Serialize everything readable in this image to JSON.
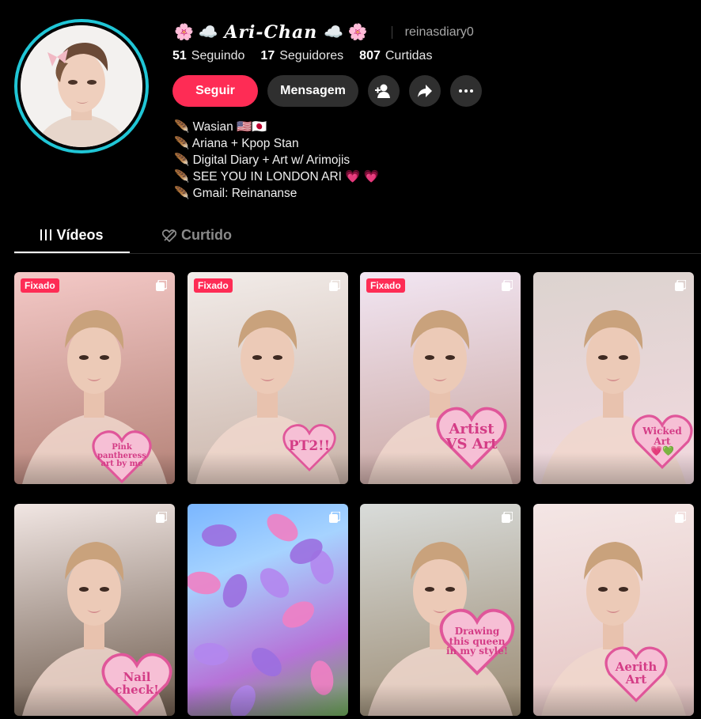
{
  "profile": {
    "display_name": "Ari-Chan",
    "emoji_left": "🌸 ☁️",
    "emoji_right": "☁️ 🌸",
    "username": "reinasdiary0",
    "avatar_icon": "avatar-photo"
  },
  "stats": [
    {
      "value": "51",
      "label": "Seguindo"
    },
    {
      "value": "17",
      "label": "Seguidores"
    },
    {
      "value": "807",
      "label": "Curtidas"
    }
  ],
  "actions": {
    "follow_label": "Seguir",
    "message_label": "Mensagem",
    "add_friend_icon": "add-friend-icon",
    "share_icon": "share-icon",
    "more_icon": "more-icon"
  },
  "bio": [
    "🪶 Wasian 🇺🇸🇯🇵",
    "🪶 Ariana + Kpop Stan",
    "🪶 Digital Diary + Art w/ Arimojis",
    "🪶 SEE YOU IN LONDON ARI 💗 💗",
    "🪶 Gmail: Reinananse"
  ],
  "tabs": [
    {
      "label": "Vídeos",
      "icon": "grid-icon",
      "active": true
    },
    {
      "label": "Curtido",
      "icon": "heart-icon",
      "active": false
    }
  ],
  "videos": [
    {
      "pinned": true,
      "badge": "Fixado",
      "caption": [
        "Pink",
        "pantheress",
        "art by me"
      ],
      "bg": [
        "#f4c9c7",
        "#b48277"
      ]
    },
    {
      "pinned": true,
      "badge": "Fixado",
      "caption": [
        "PT2!!"
      ],
      "bg": [
        "#f2ece9",
        "#c9b3a8"
      ]
    },
    {
      "pinned": true,
      "badge": "Fixado",
      "caption": [
        "Artist",
        "VS Art"
      ],
      "bg": [
        "#f2e6f3",
        "#caa7a1"
      ]
    },
    {
      "pinned": false,
      "badge": "",
      "caption": [
        "Wicked",
        "Art",
        "💗💚"
      ],
      "bg": [
        "#dcd3cf",
        "#f2d9df"
      ]
    },
    {
      "pinned": false,
      "badge": "",
      "caption": [
        "Nail",
        "check!"
      ],
      "bg": [
        "#f1e6e3",
        "#6d5b4d"
      ]
    },
    {
      "pinned": false,
      "badge": "",
      "caption": [],
      "bg": [
        "#7ab6ff",
        "#b673d8"
      ]
    },
    {
      "pinned": false,
      "badge": "",
      "caption": [
        "Drawing",
        "this queen",
        "in my style!"
      ],
      "bg": [
        "#d9dcda",
        "#9b8b73"
      ]
    },
    {
      "pinned": false,
      "badge": "",
      "caption": [
        "Aerith",
        "Art"
      ],
      "bg": [
        "#f4e6e5",
        "#e4c4c2"
      ]
    }
  ],
  "colors": {
    "accent": "#fe2c55",
    "ring": "#20c6d6",
    "heart_fill": "#f6bfd5",
    "heart_stroke": "#e0569a"
  }
}
